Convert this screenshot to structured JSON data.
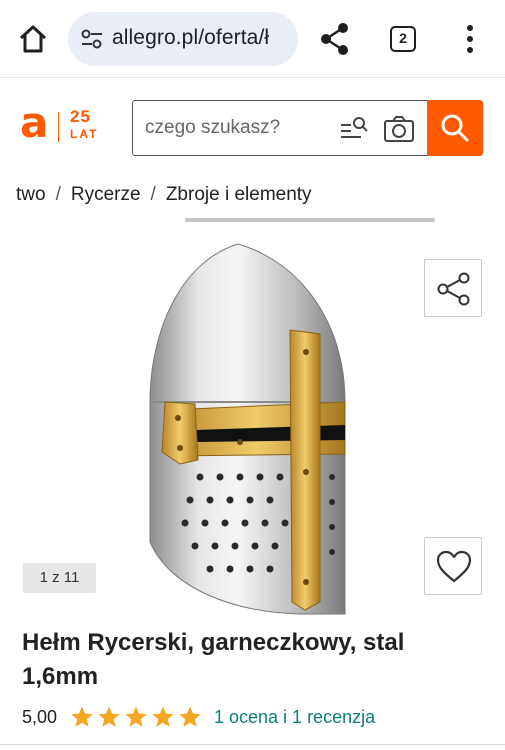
{
  "browser": {
    "url": "allegro.pl/oferta/ł",
    "tab_count": "2",
    "icons": [
      "home-icon",
      "tune-icon",
      "share-icon",
      "tabs-icon",
      "more-vert-icon"
    ]
  },
  "header": {
    "logo_letter": "a",
    "logo_anniversary": "25",
    "logo_lat": "LAT",
    "search_placeholder": "czego szukasz?",
    "brand_color": "#ff5a00"
  },
  "breadcrumb": {
    "items": [
      "two",
      "Rycerze",
      "Zbroje i elementy"
    ]
  },
  "gallery": {
    "counter": "1 z 11"
  },
  "product": {
    "title": "Hełm Rycerski, garneczkowy, stal 1,6mm",
    "rating_value": "5,00",
    "stars": 5,
    "rating_link": "1 ocena i 1 recenzja",
    "star_color": "#f5a623",
    "link_color": "#0b7f7a"
  }
}
